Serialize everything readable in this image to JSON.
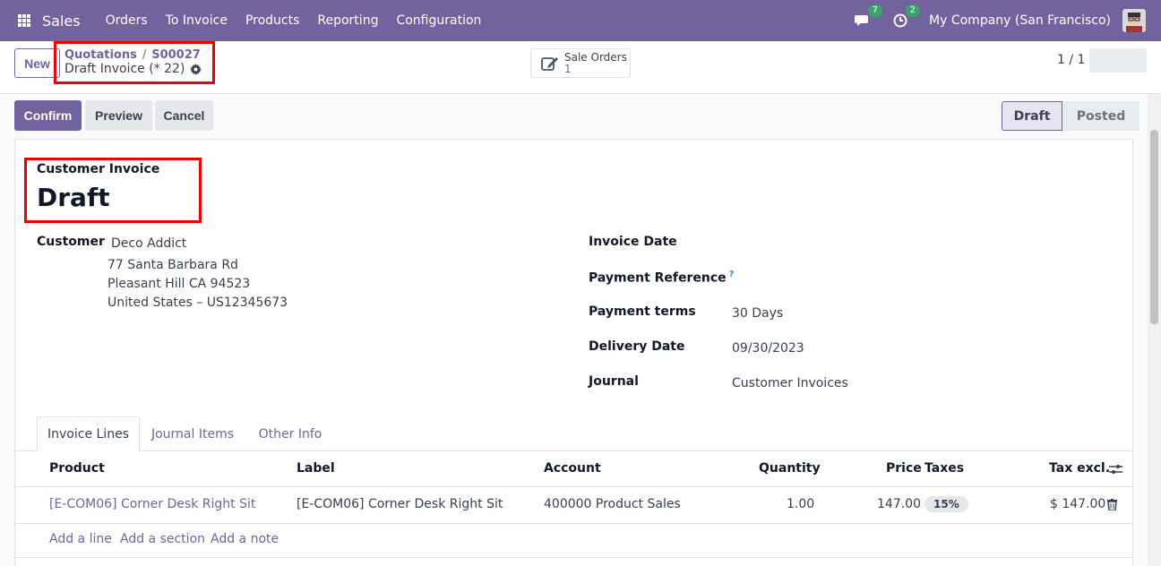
{
  "navbar": {
    "app_name": "Sales",
    "menu": [
      "Orders",
      "To Invoice",
      "Products",
      "Reporting",
      "Configuration"
    ],
    "messages_count": "7",
    "activities_count": "2",
    "company": "My Company (San Francisco)"
  },
  "control_panel": {
    "new_label": "New",
    "breadcrumb_parent": "Quotations",
    "breadcrumb_separator": "/",
    "breadcrumb_current": "S00027",
    "record_title": "Draft Invoice (* 22)",
    "smart_button_label": "Sale Orders",
    "smart_button_count": "1",
    "pager": "1 / 1"
  },
  "actions": {
    "confirm": "Confirm",
    "preview": "Preview",
    "cancel": "Cancel"
  },
  "statusbar": {
    "stages": [
      "Draft",
      "Posted"
    ],
    "active": "Draft"
  },
  "form": {
    "doc_type": "Customer Invoice",
    "doc_name": "Draft",
    "customer_label": "Customer",
    "customer_name": "Deco Addict",
    "address_line1": "77 Santa Barbara Rd",
    "address_line2": "Pleasant Hill CA 94523",
    "address_line3": "United States – US12345673",
    "invoice_date_label": "Invoice Date",
    "invoice_date_value": "",
    "payment_ref_label": "Payment Reference",
    "payment_ref_help": "?",
    "payment_terms_label": "Payment terms",
    "payment_terms_value": "30 Days",
    "delivery_date_label": "Delivery Date",
    "delivery_date_value": "09/30/2023",
    "journal_label": "Journal",
    "journal_value": "Customer Invoices"
  },
  "tabs": [
    "Invoice Lines",
    "Journal Items",
    "Other Info"
  ],
  "table": {
    "headers": {
      "product": "Product",
      "label": "Label",
      "account": "Account",
      "quantity": "Quantity",
      "price": "Price",
      "taxes": "Taxes",
      "tax_excl": "Tax excl."
    },
    "rows": [
      {
        "product": "[E-COM06] Corner Desk Right Sit",
        "label": "[E-COM06] Corner Desk Right Sit",
        "account": "400000 Product Sales",
        "quantity": "1.00",
        "price": "147.00",
        "taxes": "15%",
        "tax_excl": "$ 147.00"
      }
    ],
    "add_line": "Add a line",
    "add_section": "Add a section",
    "add_note": "Add a note"
  },
  "colors": {
    "navbar": "#71639e",
    "primary": "#71639e",
    "highlight_box": "#ee0000"
  }
}
